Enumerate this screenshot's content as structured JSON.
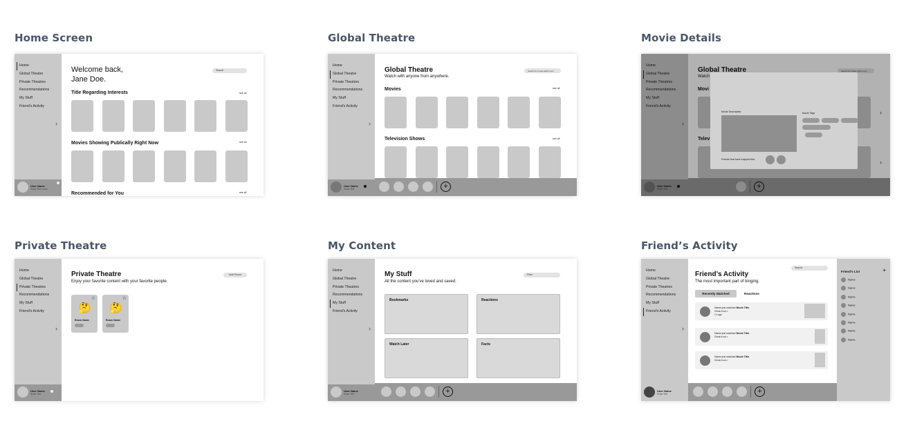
{
  "nav": [
    "Home",
    "Global Theatre",
    "Private Theatres",
    "Recommendations",
    "My Stuff",
    "Friend's Activity"
  ],
  "user": {
    "name": "User Name",
    "status": "Some Text",
    "status_home": "Some Text Lorem"
  },
  "chevron": "›",
  "plus": "+",
  "panels": {
    "home": {
      "title": "Home Screen",
      "welcome1": "Welcome back,",
      "welcome2": "Jane Doe.",
      "search": "Search",
      "sec1": "Title Regarding Interests",
      "sec2": "Movies Showing Publically Right Now",
      "sec3": "Recommended for You",
      "see_all": "see all"
    },
    "global": {
      "title": "Global Theatre",
      "heading": "Global Theatre",
      "sub": "Watch with anyone from anywhere.",
      "search": "Search for movies within room",
      "movies": "Movies",
      "tv": "Television Shows",
      "see_all": "see all"
    },
    "details": {
      "title": "Movie Details",
      "heading": "Global Theatre",
      "sub": "Watch",
      "search": "Search for movies within room",
      "movies": "Movi",
      "tv": "Telev",
      "desc": "Movie Description",
      "tags": "Movie Tags",
      "friends": "Friends that have enjoyed this:"
    },
    "private": {
      "title": "Private Theatre",
      "heading": "Private Theatre",
      "sub": "Enjoy your favorite content with your favorite people.",
      "add": "Add Room",
      "room": "Room Name",
      "star": "☆",
      "emoji": "🤔"
    },
    "content": {
      "title": "My Content",
      "heading": "My Stuff",
      "sub": "All the content you've loved and saved.",
      "filter": "Filter",
      "boxes": [
        "Bookmarks",
        "Reactions",
        "Watch Later",
        "Facts"
      ]
    },
    "friends": {
      "title": "Friend’s Activity",
      "heading": "Friend’s Activity",
      "sub": "The most important part of binging.",
      "search": "Search",
      "tab1": "Recently Watched",
      "tab2": "Reactions",
      "list_title": "Friend's List",
      "list_name": "Name",
      "feed_prefix": "Name just watched ",
      "feed_movie": "Movie Title.",
      "feed_check": "Check it out >",
      "feed_time": "1 h ago"
    }
  }
}
